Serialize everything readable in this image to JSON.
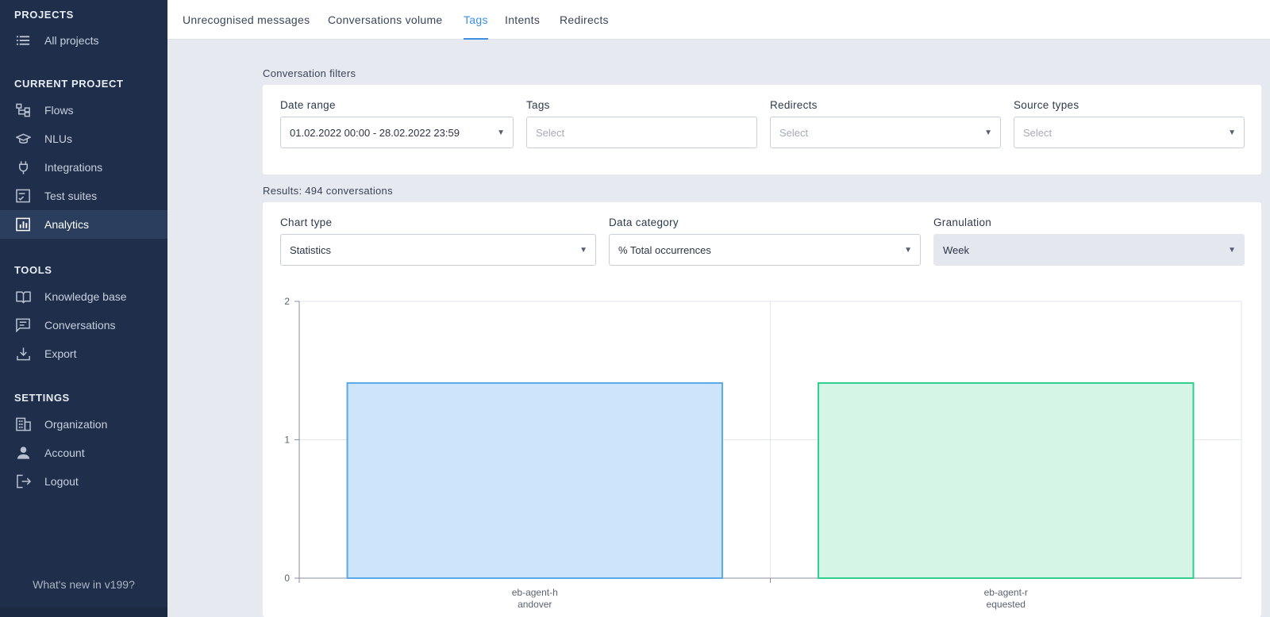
{
  "sidebar": {
    "sections": {
      "projects": "PROJECTS",
      "current_project": "CURRENT PROJECT",
      "tools": "TOOLS",
      "settings": "SETTINGS"
    },
    "items": {
      "all_projects": "All projects",
      "flows": "Flows",
      "nlus": "NLUs",
      "integrations": "Integrations",
      "test_suites": "Test suites",
      "analytics": "Analytics",
      "knowledge_base": "Knowledge base",
      "conversations": "Conversations",
      "export": "Export",
      "organization": "Organization",
      "account": "Account",
      "logout": "Logout"
    },
    "active_item": "Analytics",
    "whats_new": "What's new in v199?"
  },
  "tabs": {
    "unrecognised": "Unrecognised messages",
    "volume": "Conversations volume",
    "tags": "Tags",
    "intents": "Intents",
    "redirects": "Redirects",
    "active": "Tags"
  },
  "filters": {
    "caption": "Conversation filters",
    "date_range": {
      "label": "Date range",
      "value": "01.02.2022 00:00 - 28.02.2022 23:59"
    },
    "tags": {
      "label": "Tags",
      "placeholder": "Select"
    },
    "redirects": {
      "label": "Redirects",
      "placeholder": "Select"
    },
    "source_types": {
      "label": "Source types",
      "placeholder": "Select"
    }
  },
  "results": {
    "caption": "Results: 494 conversations",
    "chart_type": {
      "label": "Chart type",
      "value": "Statistics"
    },
    "data_category": {
      "label": "Data category",
      "value": "% Total occurrences"
    },
    "granulation": {
      "label": "Granulation",
      "value": "Week"
    }
  },
  "colors": {
    "sidebar_bg": "#1f2e4a",
    "accent": "#3d8fe0",
    "bar1_fill": "#cde5fb",
    "bar1_stroke": "#5aa9e6",
    "bar2_fill": "#d5f5e6",
    "bar2_stroke": "#2ecf8f"
  },
  "chart_data": {
    "type": "bar",
    "categories": [
      [
        "eb-agent-h",
        "andover"
      ],
      [
        "eb-agent-r",
        "equested"
      ]
    ],
    "values": [
      1.41,
      1.41
    ],
    "ylim": [
      0,
      2
    ],
    "yticks": [
      0,
      1,
      2
    ],
    "grid": true,
    "legend": "none"
  }
}
